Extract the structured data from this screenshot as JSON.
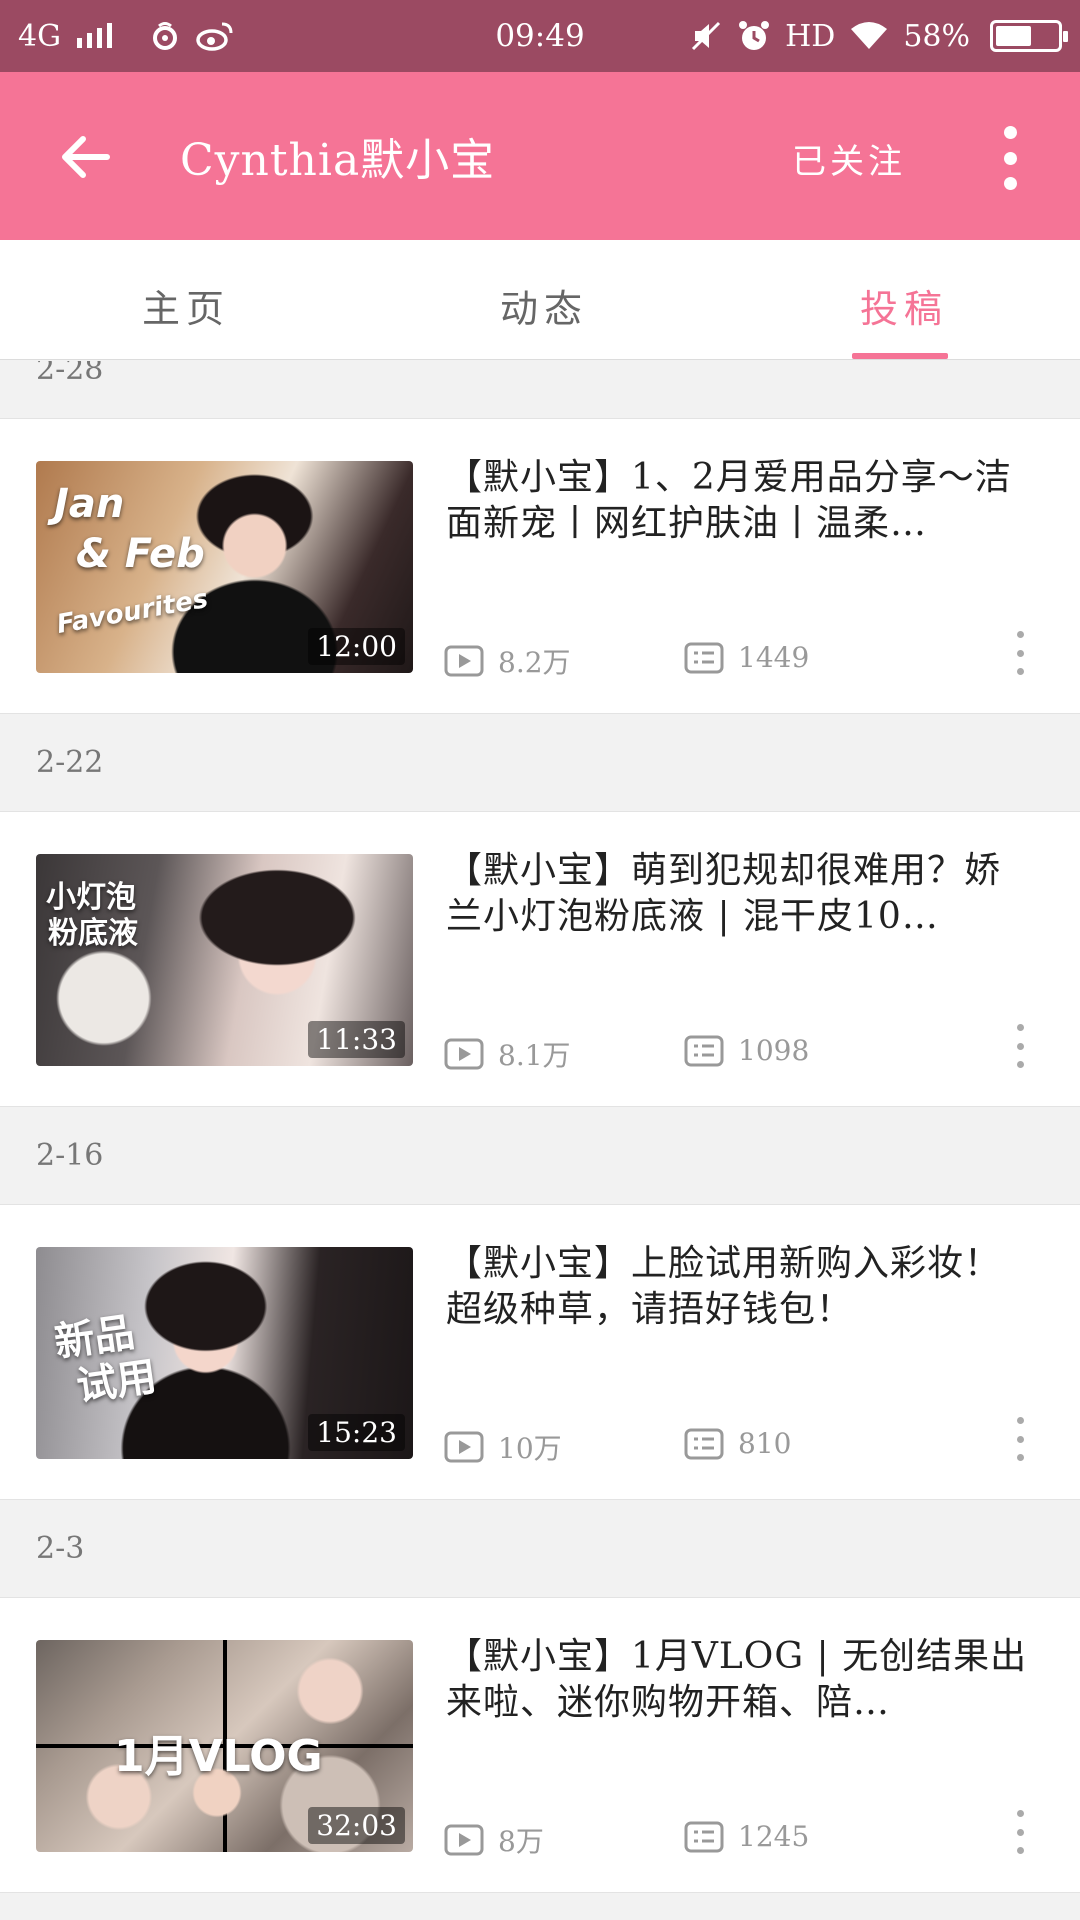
{
  "status_bar": {
    "network": "4G",
    "time": "09:49",
    "hd": "HD",
    "battery": "58%",
    "battery_level": 0.58
  },
  "app_bar": {
    "title": "Cynthia默小宝",
    "follow_label": "已关注"
  },
  "tabs": [
    {
      "label": "主页"
    },
    {
      "label": "动态"
    },
    {
      "label": "投稿",
      "active": true
    }
  ],
  "feed": {
    "partial_date": "2-28",
    "items": [
      {
        "title": "【默小宝】1、2月爱用品分享～洁面新宠丨网红护肤油丨温柔…",
        "duration": "12:00",
        "views": "8.2万",
        "danmaku": "1449",
        "thumb_text": [
          "Jan",
          "& Feb",
          "Favourites"
        ]
      },
      {
        "date": "2-22",
        "title": "【默小宝】萌到犯规却很难用？娇兰小灯泡粉底液 | 混干皮10…",
        "duration": "11:33",
        "views": "8.1万",
        "danmaku": "1098",
        "thumb_text": [
          "小灯泡",
          "粉底液"
        ]
      },
      {
        "date": "2-16",
        "title": "【默小宝】上脸试用新购入彩妆！超级种草，请捂好钱包！",
        "duration": "15:23",
        "views": "10万",
        "danmaku": "810",
        "thumb_text": [
          "新品",
          "试用"
        ]
      },
      {
        "date": "2-3",
        "title": "【默小宝】1月VLOG | 无创结果出来啦、迷你购物开箱、陪…",
        "duration": "32:03",
        "views": "8万",
        "danmaku": "1245",
        "thumb_text": [
          "1月VLOG"
        ]
      }
    ]
  },
  "colors": {
    "status_bar": "#9b4a62",
    "app_bar": "#f57496",
    "accent": "#f57496"
  }
}
